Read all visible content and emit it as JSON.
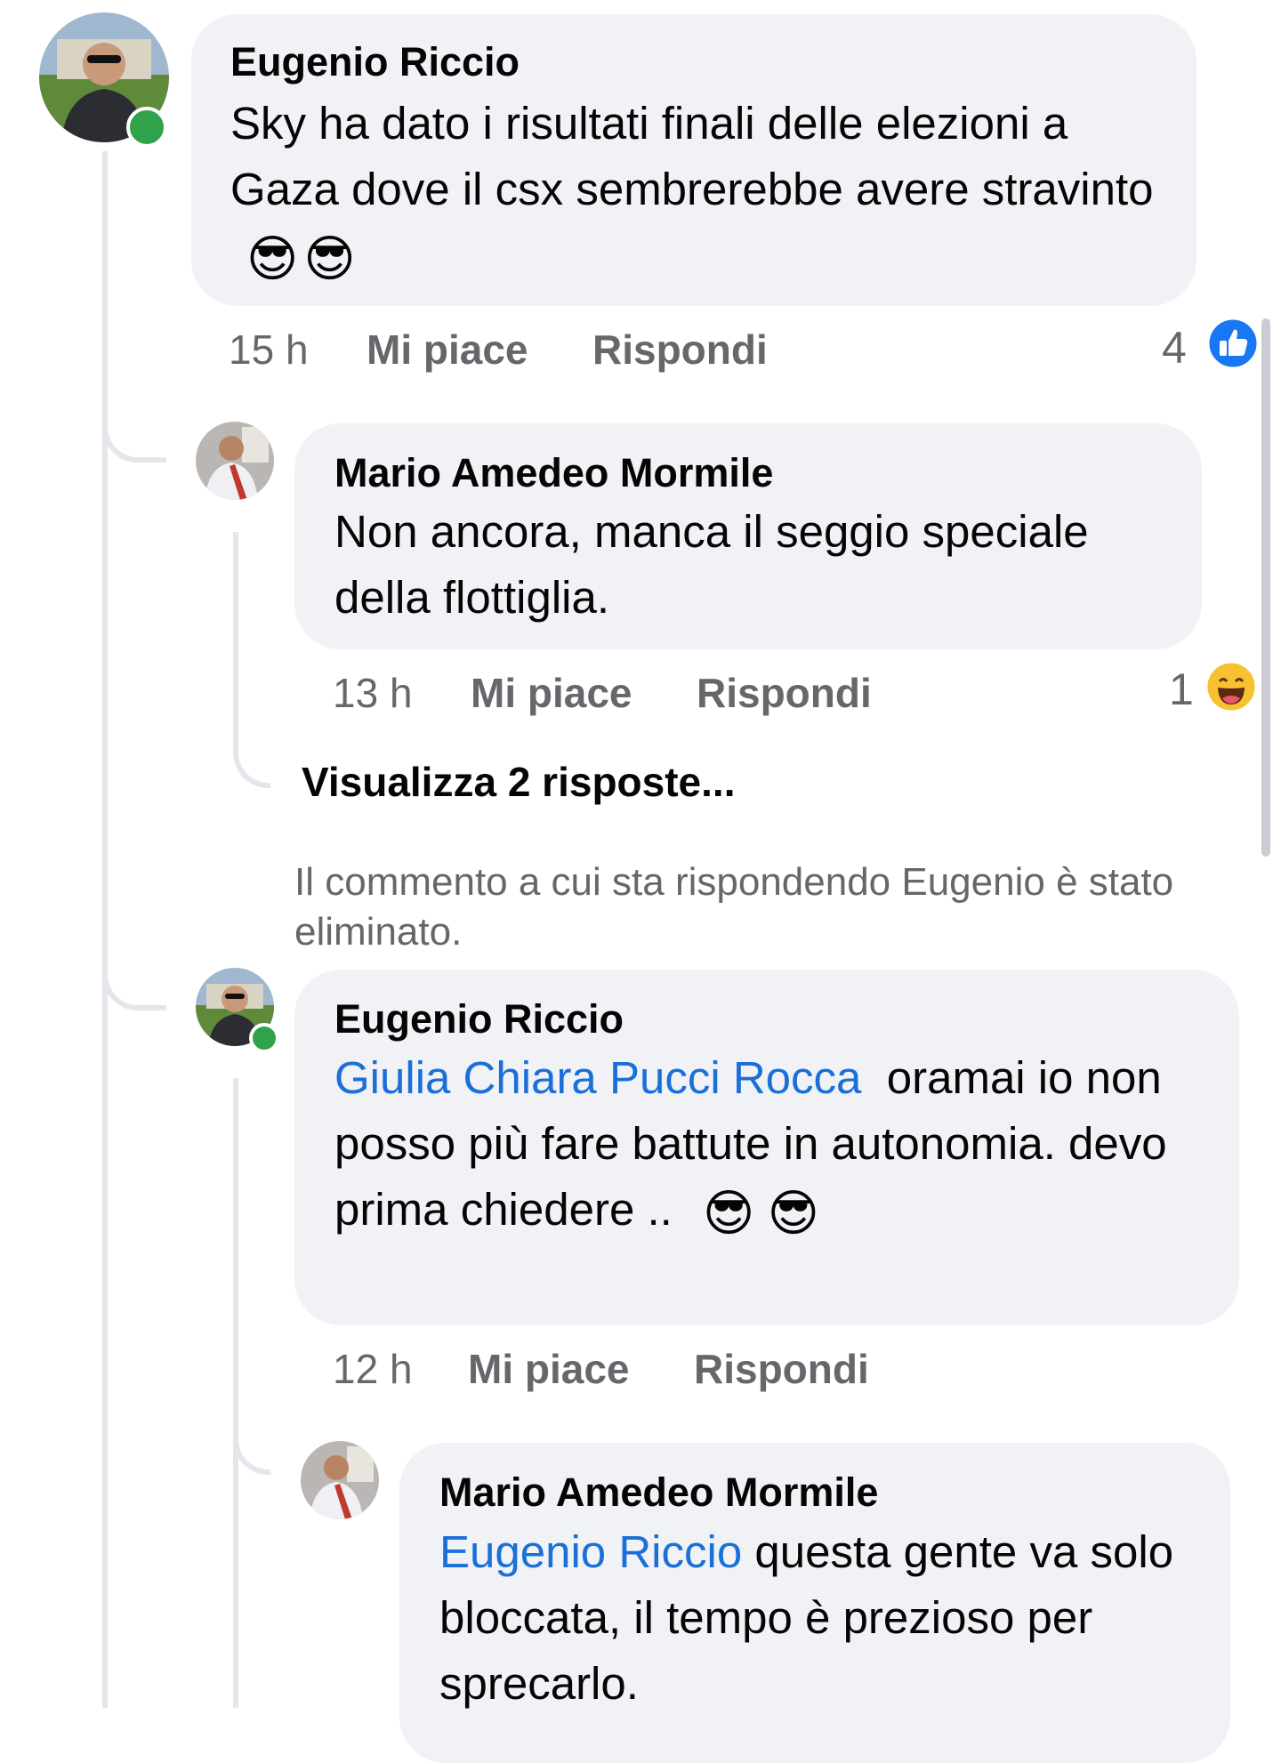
{
  "comments": [
    {
      "author": "Eugenio Riccio",
      "text": "Sky ha dato i risultati finali delle elezioni a Gaza dove il csx sembrerebbe avere stravinto",
      "emojis": "😎😎",
      "time": "15 h",
      "like_label": "Mi piace",
      "reply_label": "Rispondi",
      "reaction_count": "4",
      "reaction_icon": "like-icon"
    },
    {
      "author": "Mario Amedeo Mormile",
      "text": "Non ancora, manca il seggio speciale della flottiglia.",
      "time": "13 h",
      "like_label": "Mi piace",
      "reply_label": "Rispondi",
      "reaction_count": "1",
      "reaction_icon": "laugh-emoji-icon"
    },
    {
      "author": "Eugenio Riccio",
      "mention": "Giulia Chiara Pucci Rocca",
      "text": "oramai io non posso più fare battute in autonomia. devo prima chiedere ..",
      "time": "12 h",
      "like_label": "Mi piace",
      "reply_label": "Rispondi"
    },
    {
      "author": "Mario Amedeo Mormile",
      "mention": "Eugenio Riccio",
      "text": "questa gente va solo bloccata, il tempo è prezioso per sprecarlo."
    }
  ],
  "view_replies": "Visualizza 2 risposte...",
  "deleted_notice": "Il commento a cui sta rispondendo Eugenio è stato eliminato.",
  "colors": {
    "bubble": "#f0f2f5",
    "mention": "#1a6fd9",
    "meta": "#65676b",
    "online": "#31a24c",
    "like_blue": "#1877f2"
  }
}
